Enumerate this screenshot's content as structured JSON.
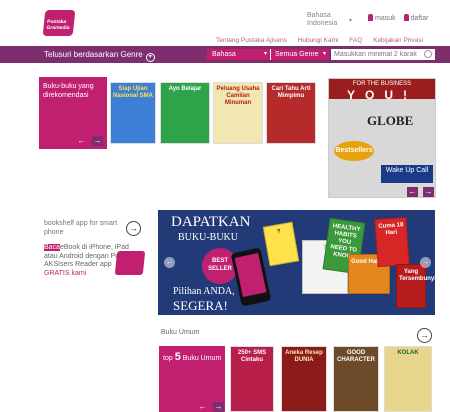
{
  "header": {
    "logo_text": "Pustaka Gramedia",
    "language_line1": "Bahasa",
    "language_line2": "Indonesia",
    "login": "masuk",
    "register": "daftar"
  },
  "top_links": [
    "Tentang Pustaka Ajisens",
    "Hubungi Kami",
    "FAQ",
    "Kebijakan Privasi"
  ],
  "genre_bar": {
    "label": "Telusuri berdasarkan Genre",
    "language_select": "Bahasa",
    "genre_select": "Semua Genre",
    "search_placeholder": "Masukkan minimal 2 karak"
  },
  "recommended": {
    "title": "Buku-buku yang direkomendasi",
    "books": [
      {
        "title": "Siap Ujian Nasional SMA",
        "color": "#3b7fd6"
      },
      {
        "title": "Ayo Belajar",
        "color": "#2fa34a"
      },
      {
        "title": "Peluang Usaha Camilan Minuman",
        "color": "#f1e7b0"
      },
      {
        "title": "Cari Tahu Arti Mimpimu",
        "color": "#b52b2b"
      }
    ],
    "featured": {
      "top": "FOR THE BUSINESS",
      "you": "YOU!",
      "globe": "GLOBE",
      "badge": "Bestsellers",
      "wake": "Wake Up Call"
    }
  },
  "app_promo": {
    "title": "bookshelf app for smart phone",
    "highlight": "Baca",
    "desc": "eBook di iPhone, iPad atau Android dengan Pustaka AKSIsers Reader app",
    "link": "GRATIS kami"
  },
  "banner": {
    "line1": "DAPATKAN",
    "line2": "BUKU-BUKU",
    "badge": "BEST SELLER",
    "line3": "Pilihan ANDA,",
    "line4": "SEGERA!",
    "books": [
      "HEALTHY HABITS YOU NEED TO KNOW",
      "Good Habits",
      "Cuma 18 Hari",
      "Yang Tersembunyi"
    ]
  },
  "general": {
    "label": "Buku Umum",
    "top_prefix": "top",
    "top_number": "5",
    "top_suffix": "Buku Umum",
    "books": [
      {
        "title": "250+ SMS Cintaku",
        "color": "#b81e4a"
      },
      {
        "title": "Aneka Resep DUNIA",
        "color": "#8b1a1a"
      },
      {
        "title": "GOOD CHARACTER",
        "color": "#6d4b2a"
      },
      {
        "title": "KOLAK",
        "color": "#e6d58a"
      }
    ]
  },
  "icons": {
    "arrow_left": "←",
    "arrow_right": "→",
    "chevron_down": "▾",
    "circle_arrow": "→"
  }
}
